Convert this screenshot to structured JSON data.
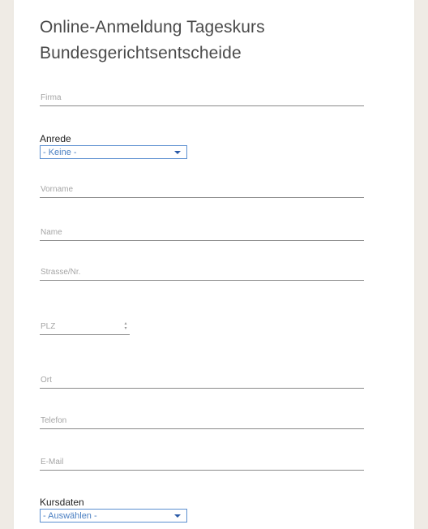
{
  "form": {
    "title_line1": "Online-Anmeldung Tageskurs",
    "title_line2": "Bundesgerichtsentscheide",
    "firma_placeholder": "Firma",
    "anrede_label": "Anrede",
    "anrede_value": "- Keine -",
    "vorname_placeholder": "Vorname",
    "name_placeholder": "Name",
    "strasse_placeholder": "Strasse/Nr.",
    "plz_placeholder": "PLZ",
    "ort_placeholder": "Ort",
    "telefon_placeholder": "Telefon",
    "email_placeholder": "E-Mail",
    "kursdaten_label": "Kursdaten",
    "kursdaten_value": "- Auswählen -"
  },
  "colors": {
    "page_background": "#efebe5",
    "card_background": "#ffffff",
    "select_border": "#5b8fd0",
    "select_text": "#4a7fc2"
  }
}
